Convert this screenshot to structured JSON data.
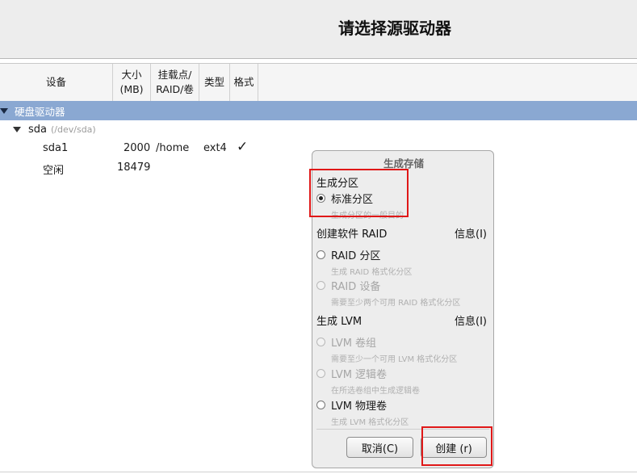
{
  "title": "请选择源驱动器",
  "columns": {
    "device": "设备",
    "size_line1": "大小",
    "size_line2": "(MB)",
    "mount_line1": "挂载点/",
    "mount_line2": "RAID/卷",
    "type": "类型",
    "format": "格式"
  },
  "tree": {
    "group_label": "硬盘驱动器",
    "disk_name": "sda",
    "disk_path": "(/dev/sda)",
    "partitions": [
      {
        "device": "sda1",
        "size": "2000",
        "mount": "/home",
        "type": "ext4",
        "format": "✓"
      },
      {
        "device": "空闲",
        "size": "18479",
        "mount": "",
        "type": "",
        "format": ""
      }
    ]
  },
  "dialog": {
    "title": "生成存储",
    "section_partition": "生成分区",
    "opt_standard": "标准分区",
    "desc_standard": "生成分区的一般目的",
    "section_raid": "创建软件 RAID",
    "info_label": "信息(I)",
    "opt_raid_partition": "RAID 分区",
    "desc_raid_partition": "生成 RAID 格式化分区",
    "opt_raid_device": "RAID 设备",
    "desc_raid_device": "需要至少两个可用 RAID 格式化分区",
    "section_lvm": "生成 LVM",
    "info_label_lvm": "信息(I)",
    "opt_lvm_vg": "LVM 卷组",
    "desc_lvm_vg": "需要至少一个可用 LVM 格式化分区",
    "opt_lvm_lv": "LVM 逻辑卷",
    "desc_lvm_lv": "在所选卷组中生成逻辑卷",
    "opt_lvm_pv": "LVM 物理卷",
    "desc_lvm_pv": "生成 LVM 格式化分区",
    "cancel_label": "取消(C)",
    "create_label": "创建 (r)",
    "selected_option": "标准分区"
  },
  "colors": {
    "group_row": "#8aa8d2",
    "highlight_box": "#e01818"
  }
}
